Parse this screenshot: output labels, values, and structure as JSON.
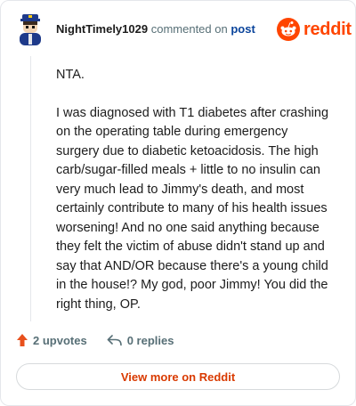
{
  "header": {
    "author": "NightTimely1029",
    "verb": "commented on",
    "target": "post",
    "brand": "reddit",
    "brand_color": "#ff4500"
  },
  "comment": {
    "paragraphs": [
      "NTA.",
      "I was diagnosed with T1 diabetes after crashing on the operating table during emergency surgery due to diabetic ketoacidosis. The high carb/sugar-filled meals + little to no insulin can very much lead to Jimmy's death, and most certainly contribute to many of his health issues worsening! And no one said anything because they felt the victim of abuse didn't stand up and say that AND/OR because there's a young child in the house!? My god, poor Jimmy! You did the right thing, OP."
    ]
  },
  "actions": {
    "upvotes": "2 upvotes",
    "replies": "0 replies",
    "upvote_icon": "upvote-arrow-icon",
    "reply_icon": "reply-arrow-icon"
  },
  "cta": {
    "label": "View more on Reddit",
    "color": "#d93a00"
  }
}
